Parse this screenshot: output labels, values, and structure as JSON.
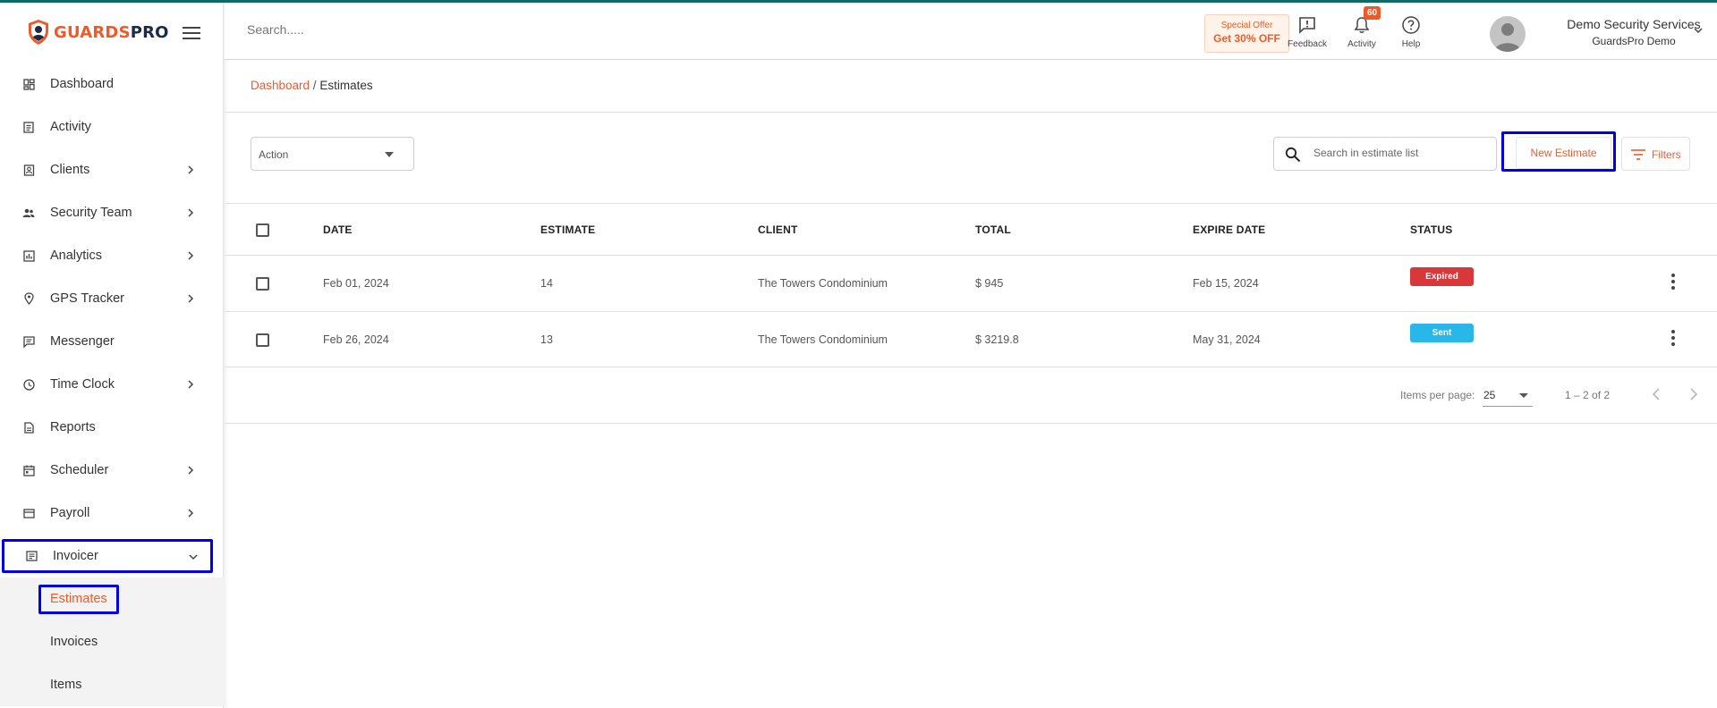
{
  "brand": {
    "name_part1": "GUARDS",
    "name_part2": "PRO",
    "accent": "#f05a28",
    "dark": "#1b2a4a"
  },
  "sidebar": {
    "items": [
      {
        "label": "Dashboard",
        "icon": "dashboard-icon"
      },
      {
        "label": "Activity",
        "icon": "activity-icon"
      },
      {
        "label": "Clients",
        "icon": "clients-icon",
        "has_children": true
      },
      {
        "label": "Security Team",
        "icon": "team-icon",
        "has_children": true
      },
      {
        "label": "Analytics",
        "icon": "analytics-icon",
        "has_children": true
      },
      {
        "label": "GPS Tracker",
        "icon": "location-pin-icon",
        "has_children": true
      },
      {
        "label": "Messenger",
        "icon": "chat-icon"
      },
      {
        "label": "Time Clock",
        "icon": "clock-icon",
        "has_children": true
      },
      {
        "label": "Reports",
        "icon": "document-icon"
      },
      {
        "label": "Scheduler",
        "icon": "calendar-icon",
        "has_children": true
      },
      {
        "label": "Payroll",
        "icon": "payroll-icon",
        "has_children": true
      },
      {
        "label": "Invoicer",
        "icon": "invoice-icon",
        "has_children": true,
        "expanded": true
      }
    ],
    "sub_items": [
      {
        "label": "Estimates",
        "active": true
      },
      {
        "label": "Invoices"
      },
      {
        "label": "Items"
      }
    ]
  },
  "header": {
    "search_placeholder": "Search.....",
    "offer_line1": "Special Offer",
    "offer_line2": "Get 30% OFF",
    "feedback_label": "Feedback",
    "activity_label": "Activity",
    "activity_count": "60",
    "help_label": "Help",
    "user_name": "Demo Security Services",
    "user_company": "GuardsPro Demo"
  },
  "breadcrumb": {
    "root": "Dashboard",
    "separator": " / ",
    "current": "Estimates"
  },
  "toolbar": {
    "action_label": "Action",
    "search_placeholder": "Search in estimate list",
    "new_estimate_label": "New Estimate",
    "filters_label": "Filters"
  },
  "table": {
    "columns": [
      "DATE",
      "ESTIMATE",
      "CLIENT",
      "TOTAL",
      "EXPIRE DATE",
      "STATUS"
    ],
    "rows": [
      {
        "date": "Feb 01, 2024",
        "estimate": "14",
        "client": "The Towers Condominium",
        "total": "$ 945",
        "expire": "Feb 15, 2024",
        "status": "Expired",
        "status_color": "#d9383a"
      },
      {
        "date": "Feb 26, 2024",
        "estimate": "13",
        "client": "The Towers Condominium",
        "total": "$ 3219.8",
        "expire": "May 31, 2024",
        "status": "Sent",
        "status_color": "#29b6e8"
      }
    ]
  },
  "pagination": {
    "items_per_page_label": "Items per page:",
    "items_per_page": "25",
    "range": "1 – 2 of 2"
  }
}
